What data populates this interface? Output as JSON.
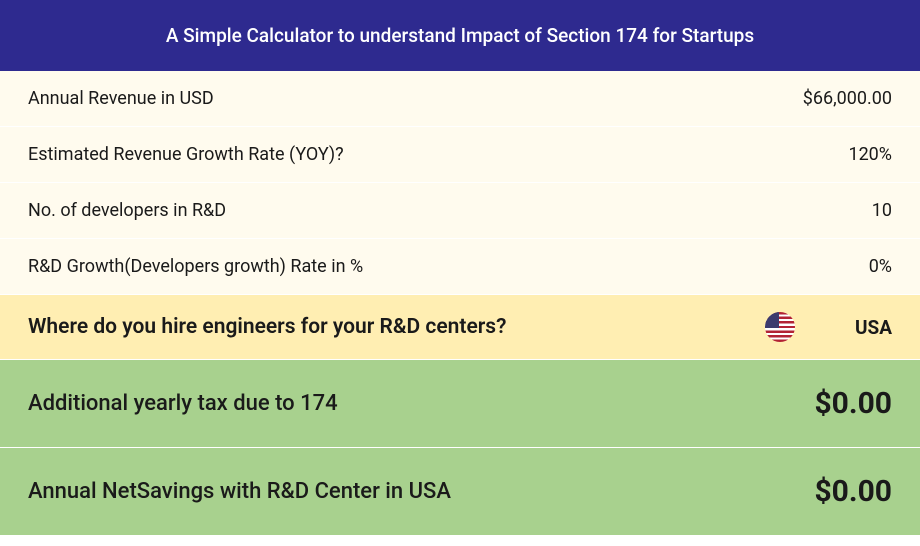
{
  "header": {
    "title": "A Simple Calculator to understand Impact of Section 174 for Startups"
  },
  "rows": {
    "revenue": {
      "label": "Annual Revenue in USD",
      "value": "$66,000.00"
    },
    "growth_rate": {
      "label": "Estimated Revenue Growth Rate (YOY)?",
      "value": "120%"
    },
    "developers": {
      "label": "No. of developers in R&D",
      "value": "10"
    },
    "rd_growth": {
      "label": "R&D Growth(Developers growth) Rate in %",
      "value": "0%"
    },
    "location": {
      "label": "Where do you hire engineers for your R&D centers?",
      "value": "USA"
    },
    "additional_tax": {
      "label": "Additional yearly tax due to 174",
      "value": "$0.00"
    },
    "net_savings": {
      "label": "Annual NetSavings with R&D Center in USA",
      "value": "$0.00"
    }
  }
}
